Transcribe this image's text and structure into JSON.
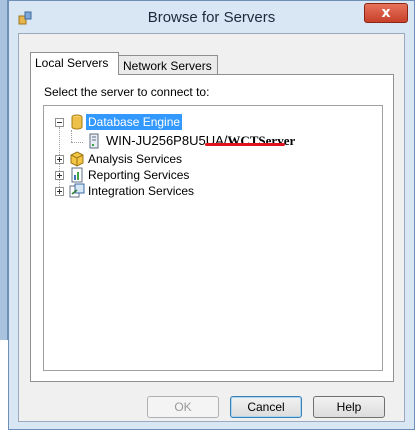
{
  "window": {
    "title": "Browse for Servers",
    "close_glyph": "x"
  },
  "tabs": [
    {
      "label": "Local Servers",
      "selected": true
    },
    {
      "label": "Network Servers",
      "selected": false
    }
  ],
  "prompt": "Select the server to connect to:",
  "tree": {
    "database_engine": "Database Engine",
    "server_name_prefix": "WIN-JU256P8U5UA/",
    "server_name_suffix": "WCTServer",
    "analysis": "Analysis Services",
    "reporting": "Reporting Services",
    "integration": "Integration Services"
  },
  "buttons": {
    "ok": "OK",
    "cancel": "Cancel",
    "help": "Help"
  },
  "colors": {
    "selection": "#3399ff",
    "annotation_underline": "#e0141e"
  }
}
